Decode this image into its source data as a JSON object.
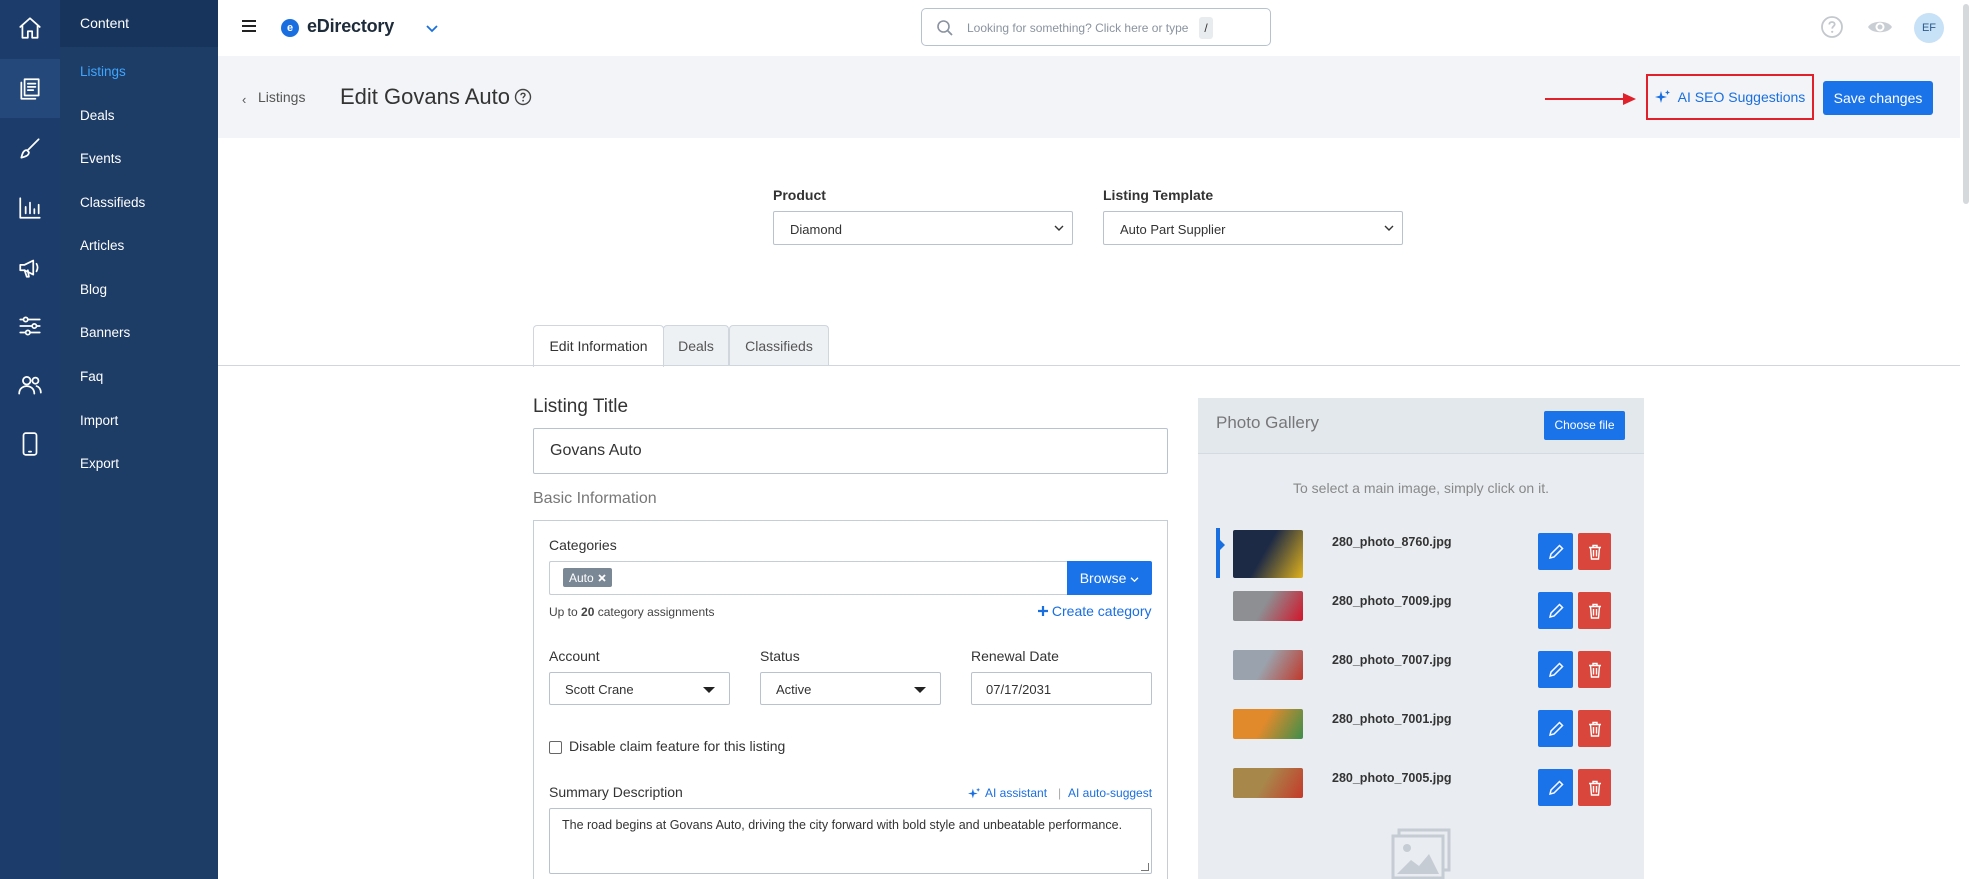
{
  "app": {
    "name": "eDirectory",
    "logo_letter": "e"
  },
  "rail": [
    "home-icon",
    "content-icon",
    "design-icon",
    "reports-icon",
    "promote-icon",
    "settings-icon",
    "users-icon",
    "mobile-icon"
  ],
  "sidebar": {
    "header": "Content",
    "items": [
      {
        "label": "Listings",
        "active": true
      },
      {
        "label": "Deals"
      },
      {
        "label": "Events"
      },
      {
        "label": "Classifieds"
      },
      {
        "label": "Articles"
      },
      {
        "label": "Blog"
      },
      {
        "label": "Banners"
      },
      {
        "label": "Faq"
      },
      {
        "label": "Import"
      },
      {
        "label": "Export"
      }
    ]
  },
  "topbar": {
    "search_placeholder": "Looking for something? Click here or type",
    "search_shortcut": "/",
    "avatar": "EF"
  },
  "header": {
    "back_label": "Listings",
    "title": "Edit Govans Auto",
    "ai_seo_label": "AI SEO Suggestions",
    "save_label": "Save changes"
  },
  "selects": {
    "product_label": "Product",
    "product_value": "Diamond",
    "template_label": "Listing Template",
    "template_value": "Auto Part Supplier"
  },
  "tabs": [
    "Edit Information",
    "Deals",
    "Classifieds"
  ],
  "form": {
    "listing_title_label": "Listing Title",
    "listing_title_value": "Govans Auto",
    "basic_info_label": "Basic Information",
    "categories_label": "Categories",
    "category_chip": "Auto",
    "browse_label": "Browse",
    "cat_hint_prefix": "Up to",
    "cat_hint_count": "20",
    "cat_hint_suffix": "category assignments",
    "create_category": "Create category",
    "account_label": "Account",
    "account_value": "Scott Crane",
    "status_label": "Status",
    "status_value": "Active",
    "renewal_label": "Renewal Date",
    "renewal_value": "07/17/2031",
    "claim_label": "Disable claim feature for this listing",
    "summary_label": "Summary Description",
    "ai_assistant": "AI assistant",
    "ai_separator": "|",
    "ai_autosuggest": "AI auto-suggest",
    "summary_text": "The road begins at Govans Auto, driving the city forward with bold style and unbeatable performance."
  },
  "gallery": {
    "title": "Photo Gallery",
    "choose_file": "Choose file",
    "hint": "To select a main image, simply click on it.",
    "photos": [
      {
        "name": "280_photo_8760.jpg",
        "colors": [
          "#1d2a45",
          "#e0b21c"
        ]
      },
      {
        "name": "280_photo_7009.jpg",
        "colors": [
          "#8d8f93",
          "#d2162a"
        ]
      },
      {
        "name": "280_photo_7007.jpg",
        "colors": [
          "#9aa3ad",
          "#c0392b"
        ]
      },
      {
        "name": "280_photo_7001.jpg",
        "colors": [
          "#e08a2c",
          "#3d8f4a"
        ]
      },
      {
        "name": "280_photo_7005.jpg",
        "colors": [
          "#a8874b",
          "#c43a2a"
        ]
      }
    ]
  },
  "colors": {
    "accent": "#1a73e8",
    "highlight_border": "#e0202a",
    "danger": "#d9473c",
    "rail": "#1c3d6b"
  }
}
